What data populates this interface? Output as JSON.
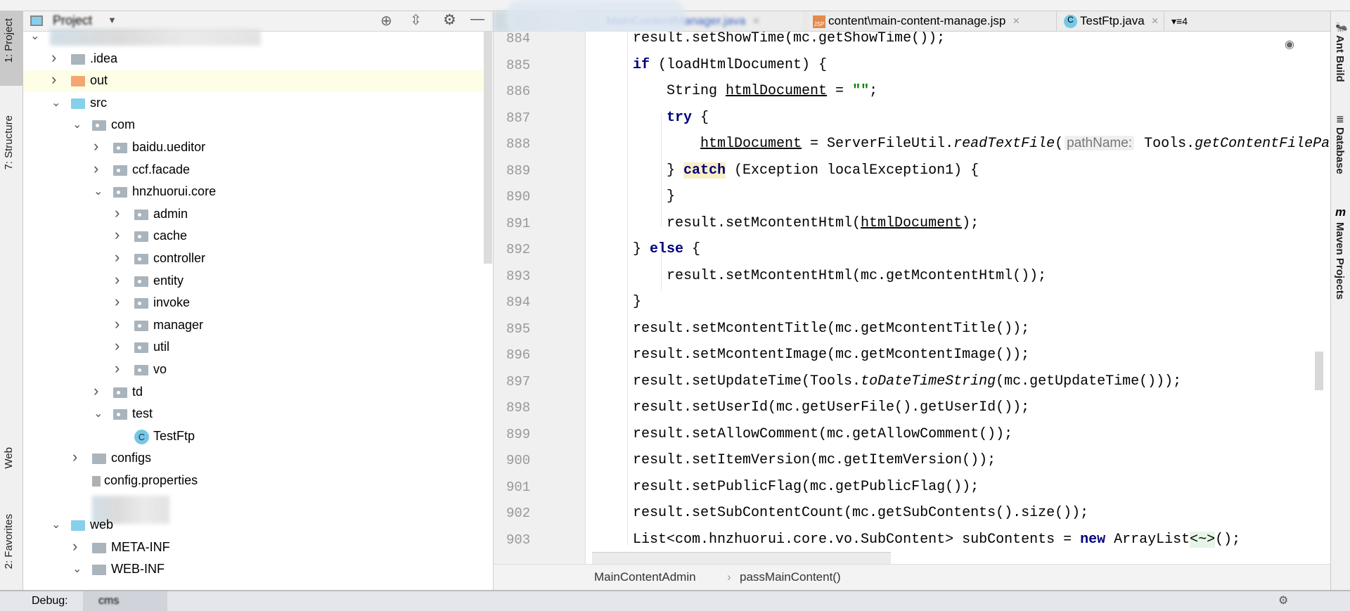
{
  "left_toolwindows": [
    {
      "label": "1: Project",
      "selected": true
    },
    {
      "label": "7: Structure"
    },
    {
      "label": "Web"
    },
    {
      "label": "2: Favorites"
    }
  ],
  "right_toolwindows": [
    {
      "label": "Ant Build"
    },
    {
      "label": "Database"
    },
    {
      "label": "Maven Projects"
    }
  ],
  "project": {
    "title": "Project",
    "tree": [
      {
        "label": "",
        "level": 0,
        "state": "expanded",
        "icon": "folder",
        "blurred": true
      },
      {
        "label": ".idea",
        "level": 1,
        "state": "collapsed",
        "icon": "folder"
      },
      {
        "label": "out",
        "level": 1,
        "state": "collapsed",
        "icon": "folder-orange",
        "highlighted": true
      },
      {
        "label": "src",
        "level": 1,
        "state": "expanded",
        "icon": "folder-blue"
      },
      {
        "label": "com",
        "level": 2,
        "state": "expanded",
        "icon": "package"
      },
      {
        "label": "baidu.ueditor",
        "level": 3,
        "state": "collapsed",
        "icon": "package"
      },
      {
        "label": "ccf.facade",
        "level": 3,
        "state": "collapsed",
        "icon": "package"
      },
      {
        "label": "hnzhuorui.core",
        "level": 3,
        "state": "expanded",
        "icon": "package"
      },
      {
        "label": "admin",
        "level": 4,
        "state": "collapsed",
        "icon": "package"
      },
      {
        "label": "cache",
        "level": 4,
        "state": "collapsed",
        "icon": "package"
      },
      {
        "label": "controller",
        "level": 4,
        "state": "collapsed",
        "icon": "package"
      },
      {
        "label": "entity",
        "level": 4,
        "state": "collapsed",
        "icon": "package"
      },
      {
        "label": "invoke",
        "level": 4,
        "state": "collapsed",
        "icon": "package"
      },
      {
        "label": "manager",
        "level": 4,
        "state": "collapsed",
        "icon": "package"
      },
      {
        "label": "util",
        "level": 4,
        "state": "collapsed",
        "icon": "package"
      },
      {
        "label": "vo",
        "level": 4,
        "state": "collapsed",
        "icon": "package"
      },
      {
        "label": "td",
        "level": 3,
        "state": "collapsed",
        "icon": "package"
      },
      {
        "label": "test",
        "level": 3,
        "state": "expanded",
        "icon": "package"
      },
      {
        "label": "TestFtp",
        "level": 4,
        "state": "none",
        "icon": "class"
      },
      {
        "label": "configs",
        "level": 2,
        "state": "collapsed",
        "icon": "folder"
      },
      {
        "label": "config.properties",
        "level": 2,
        "state": "none",
        "icon": "properties"
      },
      {
        "label": "",
        "level": 2,
        "state": "none",
        "icon": "none",
        "blurred": true
      },
      {
        "label": "web",
        "level": 1,
        "state": "expanded",
        "icon": "folder-blue"
      },
      {
        "label": "META-INF",
        "level": 2,
        "state": "collapsed",
        "icon": "folder"
      },
      {
        "label": "WEB-INF",
        "level": 2,
        "state": "expanded",
        "icon": "folder"
      }
    ]
  },
  "tabs": [
    {
      "label": "",
      "blurred": true
    },
    {
      "label": "MainContentManager.java",
      "blurred": true
    },
    {
      "label": "content\\main-content-manage.jsp",
      "icon": "jsp-icon"
    },
    {
      "label": "TestFtp.java",
      "icon": "class-icon"
    }
  ],
  "tabs_overflow": "4",
  "code": [
    {
      "n": "884",
      "indent": 1,
      "tokens": [
        {
          "t": "result.setShowTime(mc.getShowTime());"
        }
      ]
    },
    {
      "n": "885",
      "indent": 1,
      "tokens": [
        {
          "t": "if",
          "k": "kw"
        },
        {
          "t": " (loadHtmlDocument) {"
        }
      ]
    },
    {
      "n": "886",
      "indent": 2,
      "tokens": [
        {
          "t": "String "
        },
        {
          "t": "htmlDocument",
          "k": "ul"
        },
        {
          "t": " = "
        },
        {
          "t": "\"\"",
          "k": "str"
        },
        {
          "t": ";"
        }
      ]
    },
    {
      "n": "887",
      "indent": 2,
      "tokens": [
        {
          "t": "try",
          "k": "kw"
        },
        {
          "t": " {"
        }
      ]
    },
    {
      "n": "888",
      "indent": 3,
      "tokens": [
        {
          "t": "htmlDocument",
          "k": "ul"
        },
        {
          "t": " = ServerFileUtil."
        },
        {
          "t": "readTextFile",
          "k": "it"
        },
        {
          "t": "("
        },
        {
          "t": "pathName:",
          "k": "hint"
        },
        {
          "t": " Tools."
        },
        {
          "t": "getContentFilePath",
          "k": "it"
        }
      ]
    },
    {
      "n": "889",
      "indent": 2,
      "tokens": [
        {
          "t": "} "
        },
        {
          "t": "catch",
          "k": "kw-hl"
        },
        {
          "t": " (Exception localException1) {"
        }
      ]
    },
    {
      "n": "890",
      "indent": 2,
      "tokens": [
        {
          "t": "}"
        }
      ]
    },
    {
      "n": "891",
      "indent": 2,
      "tokens": [
        {
          "t": "result.setMcontentHtml("
        },
        {
          "t": "htmlDocument",
          "k": "ul"
        },
        {
          "t": ");"
        }
      ]
    },
    {
      "n": "892",
      "indent": 1,
      "tokens": [
        {
          "t": "} "
        },
        {
          "t": "else",
          "k": "kw"
        },
        {
          "t": " {"
        }
      ]
    },
    {
      "n": "893",
      "indent": 2,
      "tokens": [
        {
          "t": "result.setMcontentHtml(mc.getMcontentHtml());"
        }
      ]
    },
    {
      "n": "894",
      "indent": 1,
      "tokens": [
        {
          "t": "}"
        }
      ]
    },
    {
      "n": "895",
      "indent": 1,
      "tokens": [
        {
          "t": "result.setMcontentTitle(mc.getMcontentTitle());"
        }
      ]
    },
    {
      "n": "896",
      "indent": 1,
      "tokens": [
        {
          "t": "result.setMcontentImage(mc.getMcontentImage());"
        }
      ]
    },
    {
      "n": "897",
      "indent": 1,
      "tokens": [
        {
          "t": "result.setUpdateTime(Tools."
        },
        {
          "t": "toDateTimeString",
          "k": "it"
        },
        {
          "t": "(mc.getUpdateTime()));"
        }
      ]
    },
    {
      "n": "898",
      "indent": 1,
      "tokens": [
        {
          "t": "result.setUserId(mc.getUserFile().getUserId());"
        }
      ]
    },
    {
      "n": "899",
      "indent": 1,
      "tokens": [
        {
          "t": "result.setAllowComment(mc.getAllowComment());"
        }
      ]
    },
    {
      "n": "900",
      "indent": 1,
      "tokens": [
        {
          "t": "result.setItemVersion(mc.getItemVersion());"
        }
      ]
    },
    {
      "n": "901",
      "indent": 1,
      "tokens": [
        {
          "t": "result.setPublicFlag(mc.getPublicFlag());"
        }
      ]
    },
    {
      "n": "902",
      "indent": 1,
      "tokens": [
        {
          "t": "result.setSubContentCount(mc.getSubContents().size());"
        }
      ]
    },
    {
      "n": "903",
      "indent": 1,
      "tokens": [
        {
          "t": "List<com.hnzhuorui.core.vo.SubContent> subContents = "
        },
        {
          "t": "new",
          "k": "kw"
        },
        {
          "t": " ArrayList"
        },
        {
          "t": "<~>",
          "k": "gen"
        },
        {
          "t": "();"
        }
      ]
    }
  ],
  "breadcrumb": [
    "MainContentAdmin",
    "passMainContent()"
  ],
  "bottom": {
    "debug_label": "Debug:",
    "config": "cms"
  }
}
